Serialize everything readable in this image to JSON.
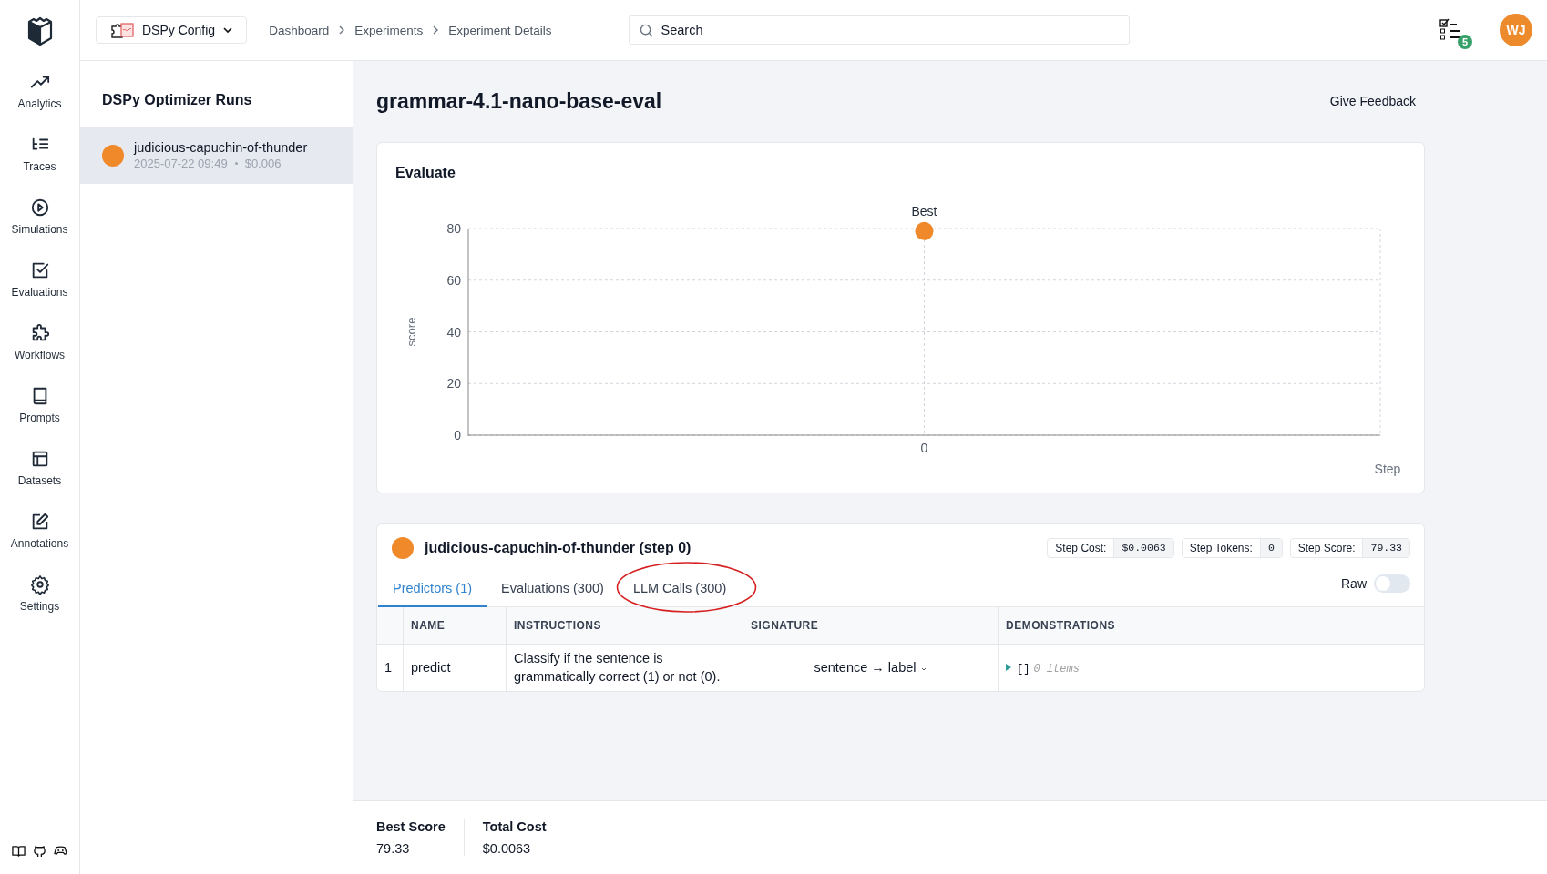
{
  "app_menu": {
    "label": "DSPy Config"
  },
  "breadcrumbs": [
    "Dashboard",
    "Experiments",
    "Experiment Details"
  ],
  "search": {
    "placeholder": "Search"
  },
  "tasks_badge": "5",
  "avatar": "WJ",
  "nav": [
    {
      "label": "Analytics",
      "selected": false
    },
    {
      "label": "Traces",
      "selected": false
    },
    {
      "label": "Simulations",
      "selected": false
    },
    {
      "label": "Evaluations",
      "selected": false
    },
    {
      "label": "Workflows",
      "selected": false
    },
    {
      "label": "Prompts",
      "selected": false
    },
    {
      "label": "Datasets",
      "selected": false
    },
    {
      "label": "Annotations",
      "selected": false
    },
    {
      "label": "Settings",
      "selected": false
    }
  ],
  "runs_panel": {
    "title": "DSPy Optimizer Runs",
    "runs": [
      {
        "name": "judicious-capuchin-of-thunder",
        "date": "2025-07-22 09:49",
        "cost": "$0.006",
        "color": "#f0892a",
        "selected": true
      }
    ]
  },
  "page_title": "grammar-4.1-nano-base-eval",
  "feedback_link": "Give Feedback",
  "chart_card": {
    "title": "Evaluate",
    "chart_data": {
      "type": "scatter",
      "xlabel": "Step",
      "ylabel": "score",
      "categories": [
        "0"
      ],
      "series": [
        {
          "color": "#f0892a",
          "values": [
            79
          ]
        }
      ],
      "ylim": [
        0,
        80
      ],
      "yticks": [
        0,
        20,
        40,
        60,
        80
      ],
      "grid": true,
      "annotations": [
        {
          "x": "0",
          "y": 79,
          "text": "Best"
        }
      ]
    }
  },
  "step_card": {
    "title": "judicious-capuchin-of-thunder (step 0)",
    "color": "#f0892a",
    "stats": [
      {
        "label": "Step Cost:",
        "value": "$0.0063"
      },
      {
        "label": "Step Tokens:",
        "value": "0"
      },
      {
        "label": "Step Score:",
        "value": "79.33"
      }
    ],
    "tabs": [
      {
        "label": "Predictors (1)",
        "selected": true,
        "circled": false
      },
      {
        "label": "Evaluations (300)",
        "selected": false,
        "circled": false
      },
      {
        "label": "LLM Calls (300)",
        "selected": false,
        "circled": true
      }
    ],
    "raw_toggle": {
      "label": "Raw",
      "on": false
    },
    "table": {
      "columns": [
        "NAME",
        "INSTRUCTIONS",
        "SIGNATURE",
        "DEMONSTRATIONS"
      ],
      "rows": [
        {
          "index": "1",
          "name": "predict",
          "instructions": "Classify if the sentence is grammatically correct (1) or not (0).",
          "signature": "sentence → label",
          "demonstrations": "[]",
          "demonstrations_count": "0 items"
        }
      ]
    }
  },
  "summary": [
    {
      "label": "Best Score",
      "value": "79.33"
    },
    {
      "label": "Total Cost",
      "value": "$0.0063"
    }
  ]
}
